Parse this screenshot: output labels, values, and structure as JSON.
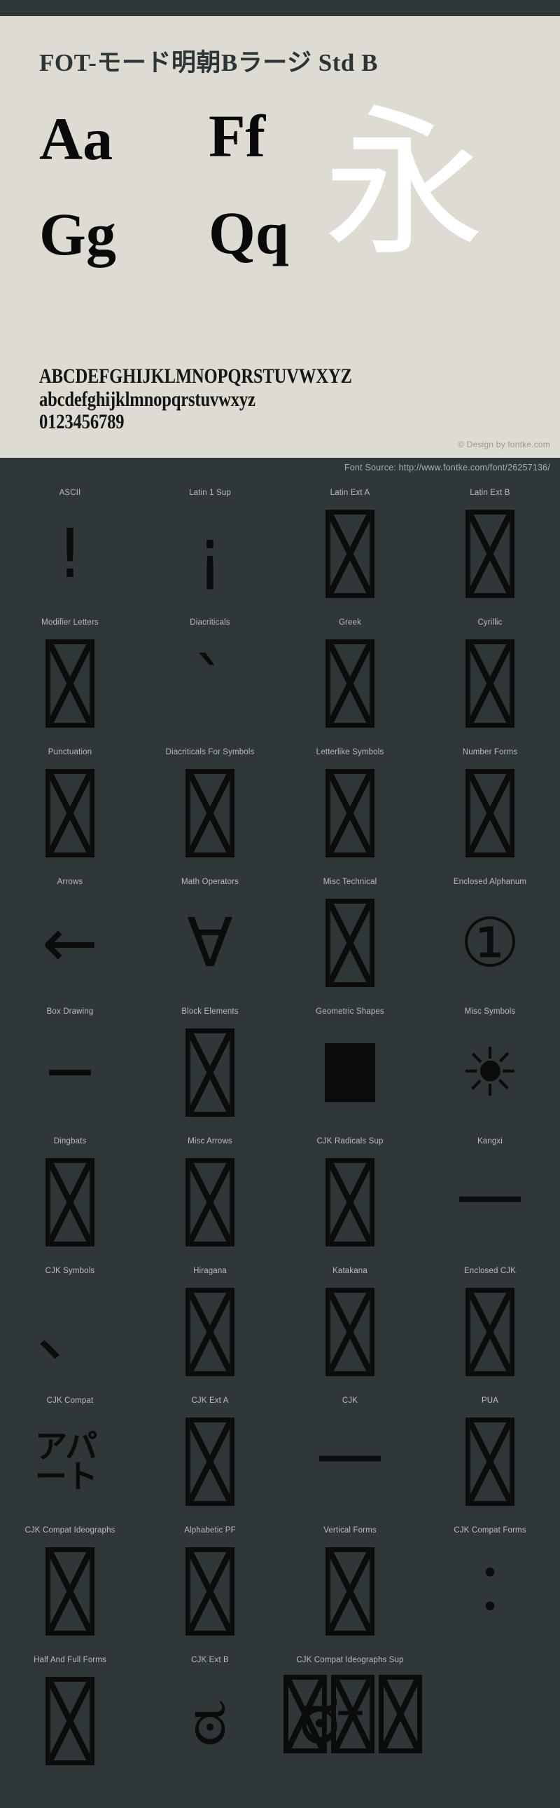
{
  "specimen": {
    "font_title": "FOT-モード明朝Bラージ Std B",
    "samples": [
      {
        "text": "Aa",
        "position": "top-left"
      },
      {
        "text": "Ff",
        "position": "top-middle"
      },
      {
        "text": "Gg",
        "position": "bottom-left"
      },
      {
        "text": "Qq",
        "position": "bottom-middle"
      },
      {
        "text": "永",
        "position": "right"
      }
    ],
    "alphabet_upper": "ABCDEFGHIJKLMNOPQRSTUVWXYZ",
    "alphabet_lower": "abcdefghijklmnopqrstuvwxyz",
    "digits": "0123456789",
    "design_credit": "© Design by fontke.com",
    "background_color": "#dedbd2",
    "text_color": "#151515",
    "cjk_glyph_color": "#ffffff"
  },
  "source_bar": {
    "text": "Font Source: http://www.fontke.com/font/26257136/",
    "background_color": "#2f3738",
    "text_color": "#a9b0b0"
  },
  "unicode_blocks": {
    "background_color": "#2f3738",
    "label_color": "#b9bebd",
    "glyph_color": "#0b0d0d",
    "rows": [
      [
        {
          "label": "ASCII",
          "sample": "!",
          "kind": "glyph",
          "icon": "exclamation-glyph"
        },
        {
          "label": "Latin 1 Sup",
          "sample": "¡",
          "kind": "glyph",
          "icon": "inverted-exclamation-glyph"
        },
        {
          "label": "Latin Ext A",
          "sample": "",
          "kind": "tofu",
          "icon": "missing-glyph-box"
        },
        {
          "label": "Latin Ext B",
          "sample": "",
          "kind": "tofu",
          "icon": "missing-glyph-box"
        }
      ],
      [
        {
          "label": "Modifier Letters",
          "sample": "",
          "kind": "tofu",
          "icon": "missing-glyph-box"
        },
        {
          "label": "Diacriticals",
          "sample": "`",
          "kind": "glyph",
          "icon": "grave-accent-glyph"
        },
        {
          "label": "Greek",
          "sample": "",
          "kind": "tofu",
          "icon": "missing-glyph-box"
        },
        {
          "label": "Cyrillic",
          "sample": "",
          "kind": "tofu",
          "icon": "missing-glyph-box"
        }
      ],
      [
        {
          "label": "Punctuation",
          "sample": "",
          "kind": "tofu",
          "icon": "missing-glyph-box"
        },
        {
          "label": "Diacriticals For Symbols",
          "sample": "",
          "kind": "tofu",
          "icon": "missing-glyph-box"
        },
        {
          "label": "Letterlike Symbols",
          "sample": "",
          "kind": "tofu",
          "icon": "missing-glyph-box"
        },
        {
          "label": "Number Forms",
          "sample": "",
          "kind": "tofu",
          "icon": "missing-glyph-box"
        }
      ],
      [
        {
          "label": "Arrows",
          "sample": "←",
          "kind": "glyph",
          "icon": "left-arrow-glyph"
        },
        {
          "label": "Math Operators",
          "sample": "∀",
          "kind": "glyph",
          "icon": "for-all-glyph"
        },
        {
          "label": "Misc Technical",
          "sample": "",
          "kind": "tofu",
          "icon": "missing-glyph-box"
        },
        {
          "label": "Enclosed Alphanum",
          "sample": "①",
          "kind": "glyph",
          "icon": "circled-one-glyph"
        }
      ],
      [
        {
          "label": "Box Drawing",
          "sample": "─",
          "kind": "glyph",
          "icon": "box-drawing-line-glyph"
        },
        {
          "label": "Block Elements",
          "sample": "",
          "kind": "tofu",
          "icon": "missing-glyph-box"
        },
        {
          "label": "Geometric Shapes",
          "sample": "■",
          "kind": "square",
          "icon": "filled-square-glyph"
        },
        {
          "label": "Misc Symbols",
          "sample": "☀",
          "kind": "glyph",
          "icon": "sun-glyph"
        }
      ],
      [
        {
          "label": "Dingbats",
          "sample": "",
          "kind": "tofu",
          "icon": "missing-glyph-box"
        },
        {
          "label": "Misc Arrows",
          "sample": "",
          "kind": "tofu",
          "icon": "missing-glyph-box"
        },
        {
          "label": "CJK Radicals Sup",
          "sample": "",
          "kind": "tofu",
          "icon": "missing-glyph-box"
        },
        {
          "label": "Kangxi",
          "sample": "⼀",
          "kind": "glyph",
          "icon": "kangxi-radical-one-glyph"
        }
      ],
      [
        {
          "label": "CJK Symbols",
          "sample": "、",
          "kind": "glyph",
          "icon": "ideographic-comma-glyph"
        },
        {
          "label": "Hiragana",
          "sample": "",
          "kind": "tofu",
          "icon": "missing-glyph-box"
        },
        {
          "label": "Katakana",
          "sample": "",
          "kind": "tofu",
          "icon": "missing-glyph-box"
        },
        {
          "label": "Enclosed CJK",
          "sample": "",
          "kind": "tofu",
          "icon": "missing-glyph-box"
        }
      ],
      [
        {
          "label": "CJK Compat",
          "sample": "アパート",
          "kind": "cjk-compat",
          "icon": "apaato-square-ligature-glyph"
        },
        {
          "label": "CJK Ext A",
          "sample": "",
          "kind": "tofu",
          "icon": "missing-glyph-box"
        },
        {
          "label": "CJK",
          "sample": "一",
          "kind": "glyph",
          "icon": "cjk-one-glyph"
        },
        {
          "label": "PUA",
          "sample": "",
          "kind": "tofu",
          "icon": "missing-glyph-box"
        }
      ],
      [
        {
          "label": "CJK Compat Ideographs",
          "sample": "",
          "kind": "tofu",
          "icon": "missing-glyph-box"
        },
        {
          "label": "Alphabetic PF",
          "sample": "",
          "kind": "tofu",
          "icon": "missing-glyph-box"
        },
        {
          "label": "Vertical Forms",
          "sample": "",
          "kind": "tofu",
          "icon": "missing-glyph-box"
        },
        {
          "label": "CJK Compat Forms",
          "sample": "︰",
          "kind": "glyph",
          "icon": "vertical-two-dot-glyph"
        }
      ],
      [
        {
          "label": "Half And Full Forms",
          "sample": "",
          "kind": "tofu",
          "icon": "missing-glyph-box"
        },
        {
          "label": "CJK Ext B",
          "sample": "ಠ",
          "kind": "glyph",
          "icon": "kannada-letter-glyph"
        },
        {
          "label": "CJK Compat Ideographs Sup",
          "sample": "ಠ",
          "kind": "cluster",
          "icon": "overlapping-missing-glyph-cluster"
        },
        {
          "label": "",
          "sample": "",
          "kind": "spacer",
          "icon": ""
        }
      ]
    ]
  }
}
